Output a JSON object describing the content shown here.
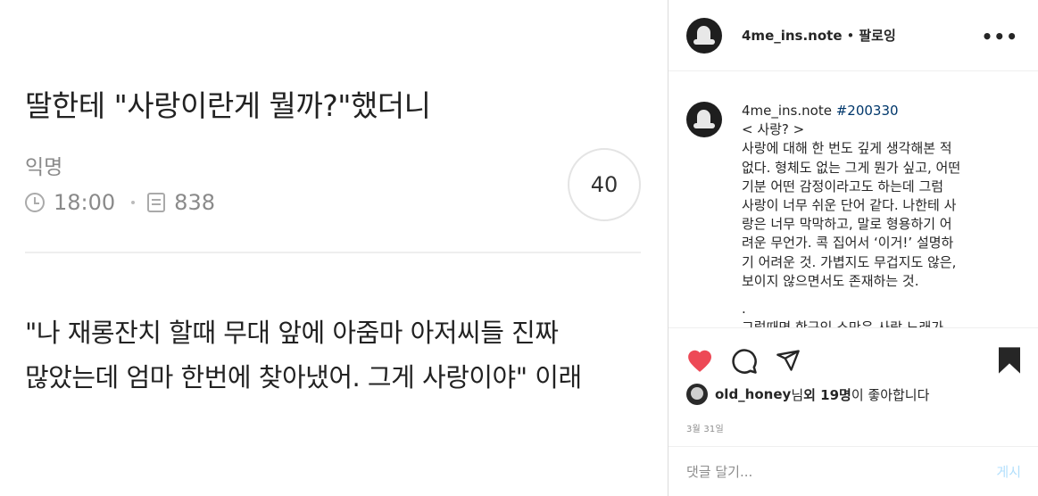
{
  "post_image": {
    "title": "딸한테 \"사랑이란게 뭘까?\"했더니",
    "author": "익명",
    "time": "18:00",
    "views": "838",
    "comment_count": "40",
    "body_lines": [
      "\"나 재롱잔치 할때 무대 앞에 아줌마 아저씨들 진짜",
      "많았는데 엄마 한번에 찾아냈어. 그게 사랑이야\" 이래"
    ]
  },
  "header": {
    "username": "4me_ins.note",
    "separator": "•",
    "follow_label": "팔로잉",
    "more_icon": "more-horizontal-icon"
  },
  "caption": {
    "username": "4me_ins.note",
    "hashtag": "#200330",
    "lines": [
      "< 사랑? >",
      "사랑에 대해 한 번도 깊게 생각해본 적",
      "없다. 형체도 없는 그게 뭔가 싶고, 어떤",
      "기분 어떤 감정이라고도 하는데 그럼",
      "사랑이 너무 쉬운 단어 같다. 나한테 사",
      "랑은 너무 막막하고, 말로 형용하기 어",
      "려운 무언가. 콕 집어서 ‘이거!’ 설명하",
      "기 어려운 것. 가볍지도 무겁지도 않은,",
      "보이지 않으면서도 존재하는 것.",
      "",
      ".",
      "그럴때면 한구인 스만은 사랑 노래가"
    ]
  },
  "actions": {
    "heart_color": "#ed4956",
    "liker_name": "old_honey",
    "likes_mid": "님 ",
    "likes_count": "외 19명",
    "likes_suffix": "이 좋아합니다",
    "date": "3월 31일"
  },
  "comment": {
    "placeholder": "댓글 달기...",
    "post_label": "게시"
  }
}
